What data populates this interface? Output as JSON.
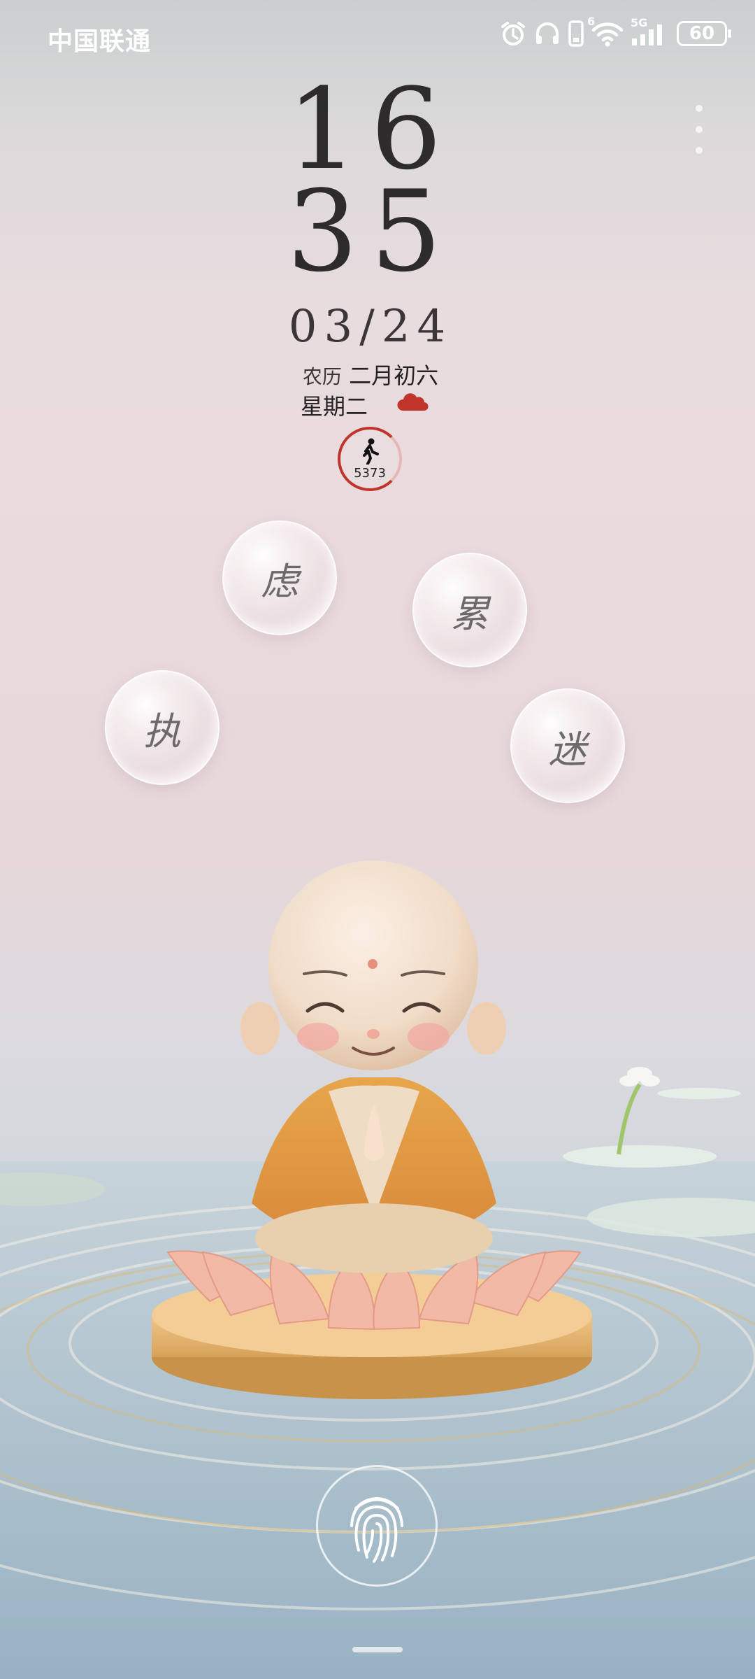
{
  "status_bar": {
    "carrier": "中国联通",
    "network": "5G",
    "wifi_badge": "6",
    "battery": "60"
  },
  "clock": {
    "hour": "16",
    "minute": "35"
  },
  "date": "03/24",
  "lunar": {
    "prefix": "农历",
    "value": "二月初六"
  },
  "weekday": "星期二",
  "weather": {
    "icon": "cloud-icon",
    "color": "#c0342a"
  },
  "steps": {
    "count": "5373",
    "icon": "walking-icon",
    "ring_color": "#c0342a"
  },
  "bubbles": {
    "b1": "虑",
    "b2": "累",
    "b3": "执",
    "b4": "迷"
  }
}
